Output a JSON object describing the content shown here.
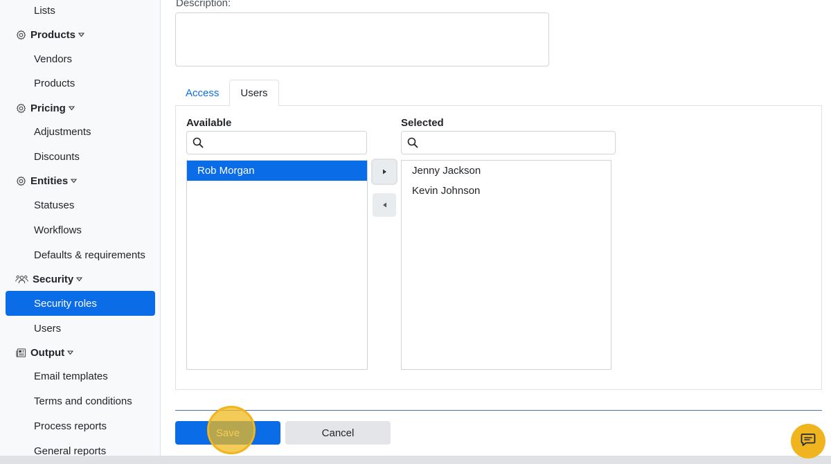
{
  "sidebar": {
    "items": [
      {
        "label": "Lists"
      },
      {
        "label": "Products",
        "group": true
      },
      {
        "label": "Vendors"
      },
      {
        "label": "Products"
      },
      {
        "label": "Pricing",
        "group": true
      },
      {
        "label": "Adjustments"
      },
      {
        "label": "Discounts"
      },
      {
        "label": "Entities",
        "group": true
      },
      {
        "label": "Statuses"
      },
      {
        "label": "Workflows"
      },
      {
        "label": "Defaults & requirements"
      },
      {
        "label": "Security",
        "group": true
      },
      {
        "label": "Security roles",
        "active": true
      },
      {
        "label": "Users"
      },
      {
        "label": "Output",
        "group": true
      },
      {
        "label": "Email templates"
      },
      {
        "label": "Terms and conditions"
      },
      {
        "label": "Process reports"
      },
      {
        "label": "General reports"
      }
    ],
    "icons": {
      "products": "gear-icon",
      "pricing": "gear-icon",
      "entities": "gear-icon",
      "security": "users-icon",
      "output": "newspaper-icon"
    }
  },
  "form": {
    "description_label": "Description:",
    "description_value": ""
  },
  "tabs": [
    {
      "label": "Access",
      "active": false
    },
    {
      "label": "Users",
      "active": true
    }
  ],
  "users_panel": {
    "available": {
      "title": "Available",
      "search_value": "",
      "items": [
        "Rob Morgan"
      ],
      "selected_item": "Rob Morgan"
    },
    "selected": {
      "title": "Selected",
      "search_value": "",
      "items": [
        "Jenny Jackson",
        "Kevin Johnson"
      ]
    },
    "move_right_icon": "caret-right-icon",
    "move_left_icon": "caret-left-icon"
  },
  "actions": {
    "save_label": "Save",
    "cancel_label": "Cancel"
  },
  "colors": {
    "accent": "#0b6ce8",
    "highlight": "#f0b41e"
  }
}
